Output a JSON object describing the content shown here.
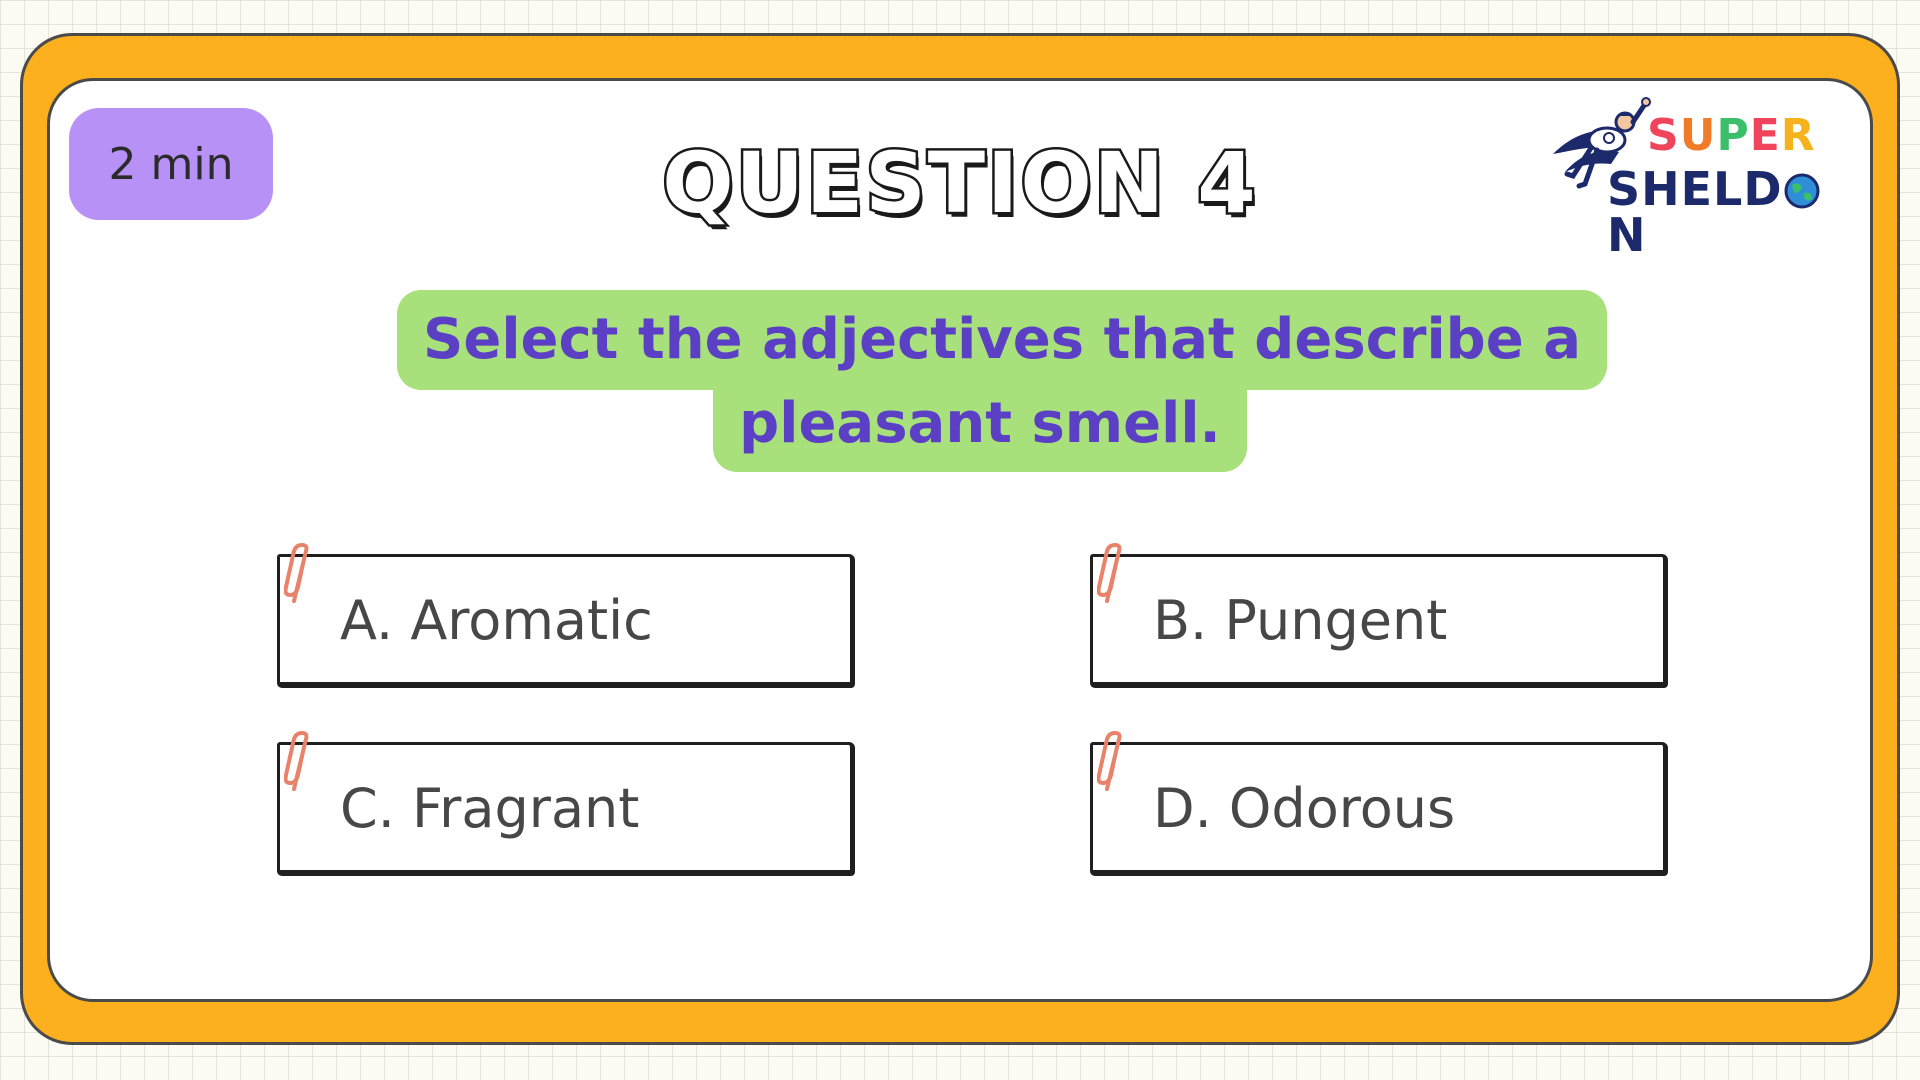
{
  "timer": {
    "label": "2 min"
  },
  "header": {
    "title": "QUESTION 4"
  },
  "logo": {
    "super_letters": [
      {
        "char": "S",
        "color": "#f0445c"
      },
      {
        "char": "U",
        "color": "#f07c2a"
      },
      {
        "char": "P",
        "color": "#3cbf6a"
      },
      {
        "char": "E",
        "color": "#f0445c"
      },
      {
        "char": "R",
        "color": "#f5b21a"
      }
    ],
    "sheldon_text": "SHELD",
    "sheldon_tail": "N",
    "icon": "superhero-icon",
    "globe_icon": "globe-icon"
  },
  "prompt": {
    "line1": "Select the adjectives that describe a",
    "line2": "pleasant smell."
  },
  "options": [
    {
      "label": "A. Aromatic"
    },
    {
      "label": "B. Pungent"
    },
    {
      "label": "C. Fragrant"
    },
    {
      "label": "D. Odorous"
    }
  ],
  "colors": {
    "frame": "#fdb01e",
    "timer_bg": "#b891f7",
    "prompt_bg": "#a8e07c",
    "prompt_text": "#5b3fc4",
    "paperclip": "#e8826a"
  }
}
